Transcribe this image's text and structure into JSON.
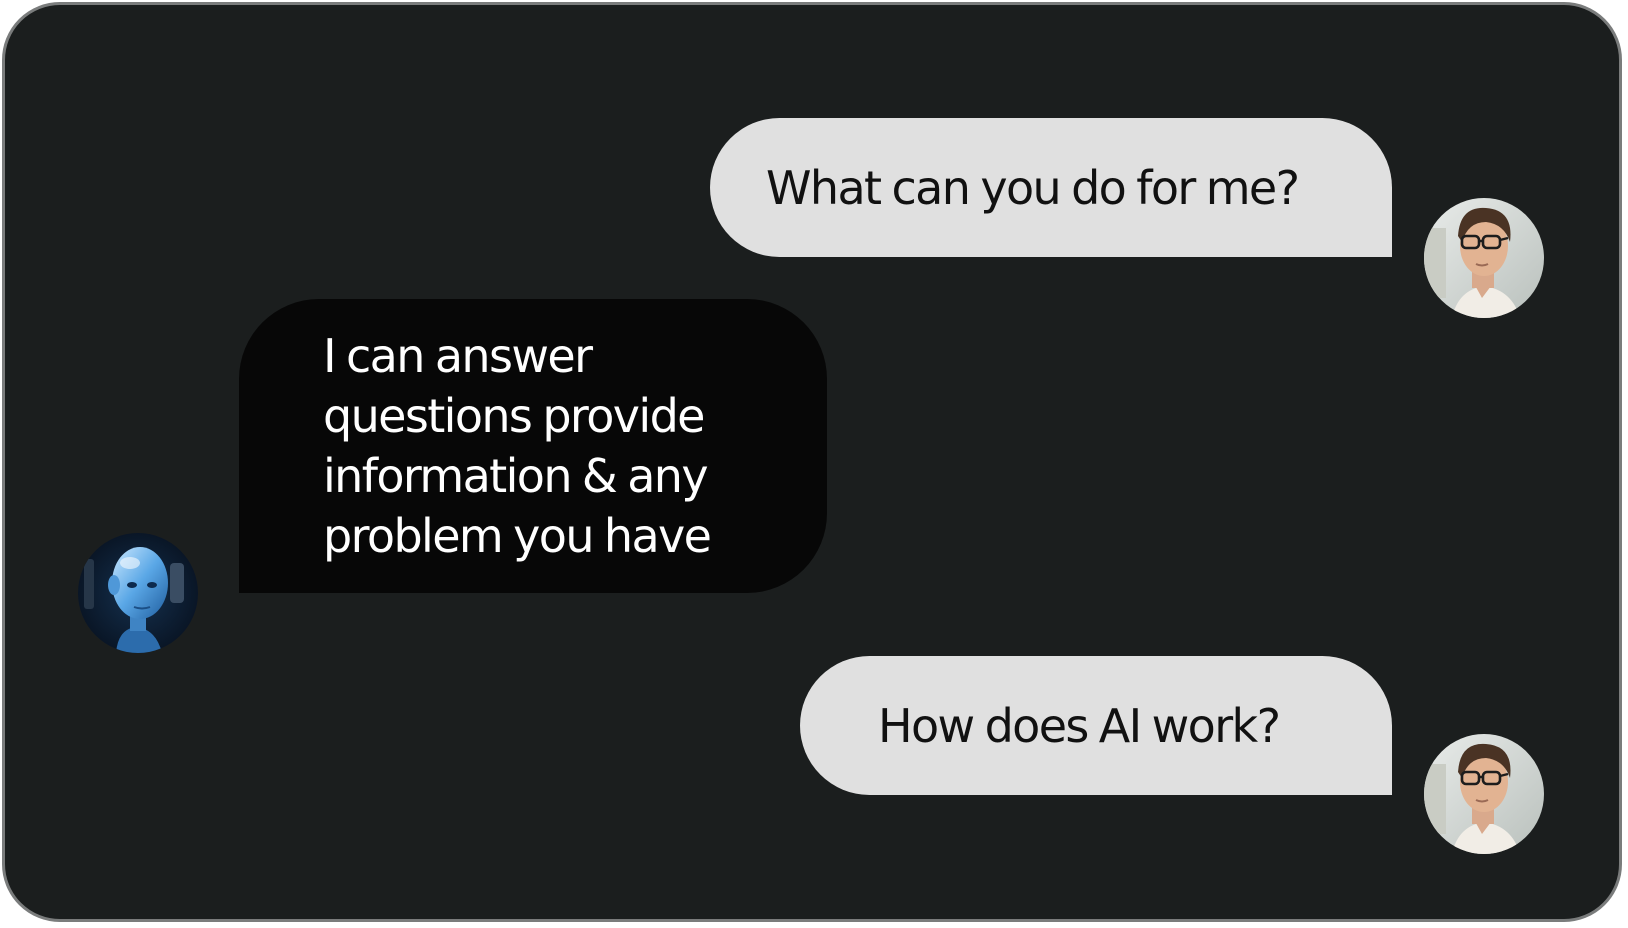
{
  "messages": [
    {
      "sender": "user",
      "text": "What can you do for me?",
      "avatar_icon": "man-with-glasses-avatar-icon"
    },
    {
      "sender": "assistant",
      "text": "I can answer questions provide information & any problem you have",
      "avatar_icon": "robot-avatar-icon"
    },
    {
      "sender": "user",
      "text": "How does AI work?",
      "avatar_icon": "man-with-glasses-avatar-icon"
    }
  ],
  "colors": {
    "background": "#1b1e1e",
    "border": "#7a7c7c",
    "user_bubble": "#e0e0e0",
    "user_text": "#111111",
    "assistant_bubble": "#070707",
    "assistant_text": "#ffffff"
  }
}
